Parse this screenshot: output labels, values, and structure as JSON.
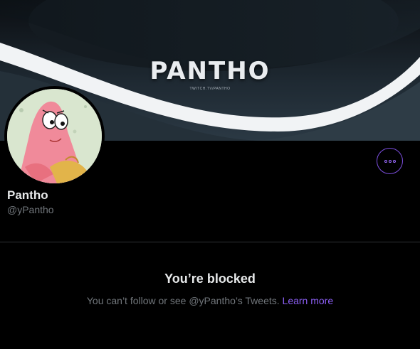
{
  "profile": {
    "banner_title": "PANTHO",
    "banner_subtitle": "TWITCH.TV/PANTHO",
    "display_name": "Pantho",
    "handle": "@yPantho"
  },
  "actions": {
    "more_icon": "more-horizontal-icon"
  },
  "blocked": {
    "title": "You’re blocked",
    "message": "You can’t follow or see @yPantho’s Tweets.",
    "learn_more": "Learn more"
  },
  "colors": {
    "background": "#000000",
    "accent": "#8c5ff5",
    "secondary_text": "#71767b"
  }
}
